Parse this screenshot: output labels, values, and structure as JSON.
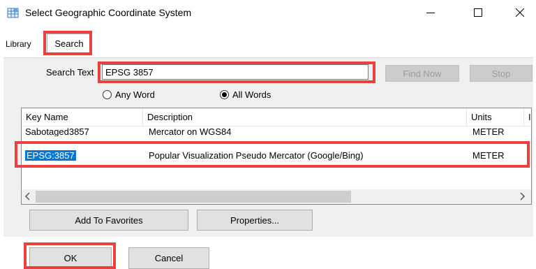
{
  "window": {
    "title": "Select Geographic Coordinate System",
    "minimize_glyph": "—",
    "maximize_glyph": "☐",
    "close_glyph": "✕"
  },
  "tabs": [
    {
      "label": "Library",
      "selected": false
    },
    {
      "label": "Search",
      "selected": true
    }
  ],
  "search": {
    "label": "Search Text",
    "value": "EPSG 3857",
    "find_now_label": "Find Now",
    "stop_label": "Stop"
  },
  "match_mode": {
    "options": [
      {
        "label": "Any Word",
        "checked": false
      },
      {
        "label": "All Words",
        "checked": true
      }
    ]
  },
  "results": {
    "columns": [
      "Key Name",
      "Description",
      "Units",
      "I"
    ],
    "rows": [
      {
        "key": "Sabotaged3857",
        "description": "Mercator on WGS84",
        "units": "METER",
        "selected": false
      },
      {
        "key": "EPSG:3857",
        "description": "Popular Visualization Pseudo Mercator (Google/Bing)",
        "units": "METER",
        "selected": true
      }
    ]
  },
  "actions": {
    "add_favorites_label": "Add To Favorites",
    "properties_label": "Properties...",
    "ok_label": "OK",
    "cancel_label": "Cancel"
  },
  "colors": {
    "highlight_box": "#e8413f",
    "selection": "#0078d7",
    "panel_bg": "#f0f0f0"
  },
  "icons": {
    "app": "globe-grid-icon",
    "scroll_left": "chevron-left-icon",
    "scroll_right": "chevron-right-icon"
  }
}
